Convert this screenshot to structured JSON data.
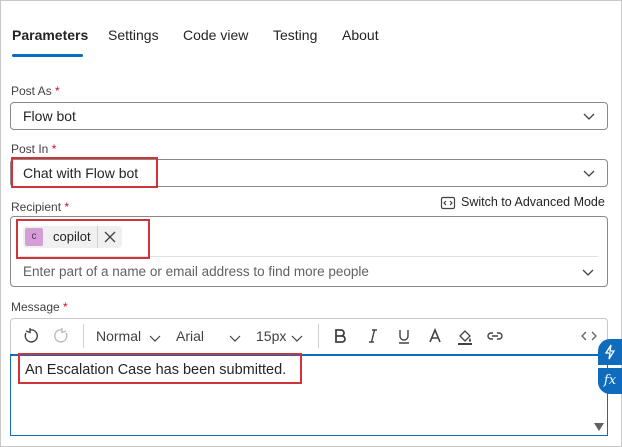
{
  "tabs": [
    {
      "label": "Parameters",
      "active": true
    },
    {
      "label": "Settings"
    },
    {
      "label": "Code view"
    },
    {
      "label": "Testing"
    },
    {
      "label": "About"
    }
  ],
  "post_as": {
    "label": "Post As",
    "required_mark": "*",
    "value": "Flow bot"
  },
  "post_in": {
    "label": "Post In",
    "required_mark": "*",
    "value": "Chat with Flow bot"
  },
  "recipient": {
    "label": "Recipient",
    "required_mark": "*",
    "switch_label": "Switch to Advanced Mode",
    "chip": {
      "initial": "c",
      "name": "copilot"
    },
    "placeholder": "Enter part of a name or email address to find more people"
  },
  "message": {
    "label": "Message",
    "required_mark": "*",
    "toolbar": {
      "style": "Normal",
      "font": "Arial",
      "size": "15px"
    },
    "body": "An Escalation Case has been submitted."
  },
  "colors": {
    "accent": "#0f6cbd",
    "highlight": "#d13438",
    "required": "#c50f1f",
    "chip_avatar": "#d59ed7"
  }
}
